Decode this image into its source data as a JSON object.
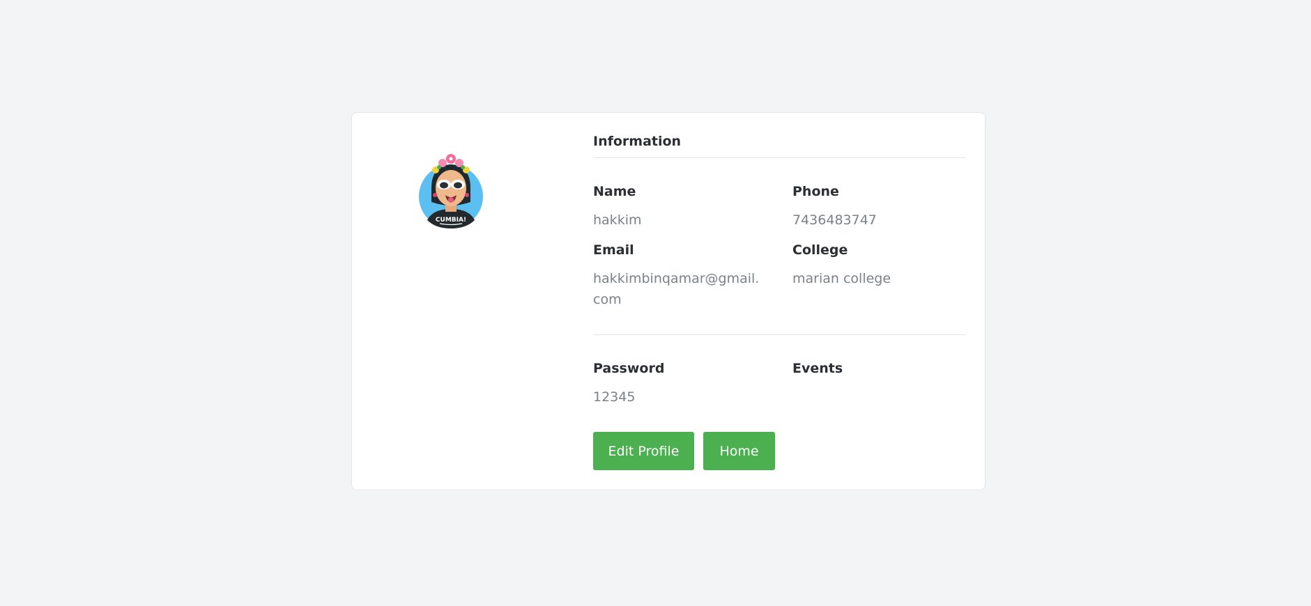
{
  "profile": {
    "section_title": "Information",
    "fields": {
      "name": {
        "label": "Name",
        "value": "hakkim"
      },
      "phone": {
        "label": "Phone",
        "value": "7436483747"
      },
      "email": {
        "label": "Email",
        "value": "hakkimbinqamar@gmail.com"
      },
      "college": {
        "label": "College",
        "value": "marian college"
      },
      "password": {
        "label": "Password",
        "value": "12345"
      },
      "events": {
        "label": "Events",
        "value": ""
      }
    },
    "avatar": {
      "shirt_text": "CUMBIA!"
    }
  },
  "actions": {
    "edit_label": "Edit Profile",
    "home_label": "Home"
  },
  "colors": {
    "page_bg": "#f3f4f6",
    "button_green": "#4caf50",
    "avatar_bg": "#5bbff2"
  }
}
